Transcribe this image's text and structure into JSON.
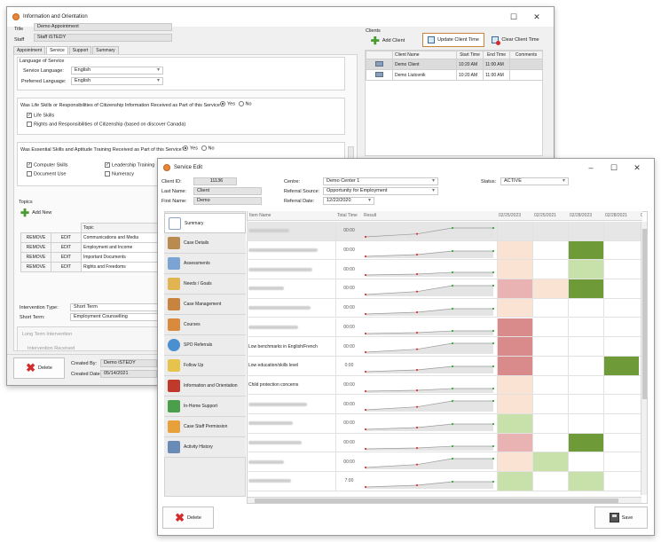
{
  "info_window": {
    "title": "Information and Orientation",
    "labels": {
      "title": "Title",
      "staff": "Staff"
    },
    "title_value": "Demo Appointment",
    "staff_value": "Staff iSTEDY",
    "tabs": [
      "Appointment",
      "Service",
      "Support",
      "Summary"
    ],
    "language_group": "Language of Service",
    "service_language_label": "Service Language:",
    "service_language": "English",
    "preferred_language_label": "Preferred Language:",
    "preferred_language": "English",
    "q_life_skills": "Was Life Skills or Responsibilities of Citizenship Information Received as Part of this Service?",
    "yes": "Yes",
    "no": "No",
    "life_skills": "Life Skills",
    "rights": "Rights and Responsibilities of Citizenship (based on discover Canada)",
    "q_essential": "Was Essential Skills and Aptitude Training Received as Part of this Service?",
    "essential_checks": [
      "Computer Skills",
      "Leadership Training",
      "Document Use",
      "Numeracy"
    ],
    "topics_label": "Topics",
    "add_new": "Add New",
    "topic_header": "Topic",
    "remove": "REMOVE",
    "edit": "EDIT",
    "topics": [
      "Communications and Media",
      "Employment and Income",
      "Important Documents",
      "Rights and Freedoms"
    ],
    "intervention_type_label": "Intervention Type:",
    "intervention_type": "Short Term",
    "short_term_label": "Short Term:",
    "short_term": "Employment Counselling",
    "long_term_label": "Long Term Intervention",
    "intervention_received": "Intervention Received",
    "delete": "Delete",
    "created_by_label": "Created By:",
    "created_by": "Demo iSTEDY",
    "created_date_label": "Created Date:",
    "created_date": "05/14/2021",
    "clients_label": "Clients",
    "add_client": "Add Client",
    "update_client_time": "Update Client Time",
    "clear_client_time": "Clear Client Time",
    "client_headers": [
      "Client Name",
      "Start Time",
      "End Time",
      "Comments"
    ],
    "clients": [
      {
        "name": "Demo Client",
        "start": "10:20 AM",
        "end": "11:00 AM",
        "comments": ""
      },
      {
        "name": "Demo Liutovnik",
        "start": "10:20 AM",
        "end": "11:00 AM",
        "comments": ""
      }
    ]
  },
  "service_window": {
    "title": "Service Edit",
    "client_id_label": "Client ID:",
    "client_id": "11136",
    "last_name_label": "Last Name:",
    "last_name": "Client",
    "first_name_label": "First Name:",
    "first_name": "Demo",
    "centre_label": "Centre:",
    "centre": "Demo Center 1",
    "referral_source_label": "Referral Source:",
    "referral_source": "Opportunity for Employment",
    "referral_date_label": "Referral Date:",
    "referral_date": "12/22/2020",
    "status_label": "Status:",
    "status": "ACTIVE",
    "sidebar": [
      "Summary",
      "Case Details",
      "Assessments",
      "Needs / Goals",
      "Case Management",
      "Courses",
      "SPO Referrals",
      "Follow Up",
      "Information and Orientation",
      "In-Home Support",
      "Case Staff Permission",
      "Activity History"
    ],
    "grid_headers": {
      "item": "Item Name",
      "time": "Total Time",
      "result": "Result",
      "dates": [
        "02/25/2023",
        "02/25/2021",
        "02/28/2023",
        "02/28/2021",
        "02/2"
      ]
    },
    "rows": [
      {
        "name": "",
        "time": "00:00"
      },
      {
        "name": "",
        "time": "00:00"
      },
      {
        "name": "",
        "time": "00:00"
      },
      {
        "name": "",
        "time": "00:00"
      },
      {
        "name": "",
        "time": "00:00"
      },
      {
        "name": "",
        "time": "00:00"
      },
      {
        "name": "Low benchmarks in English/French",
        "time": "00:00"
      },
      {
        "name": "Low education/skills level",
        "time": "0:00"
      },
      {
        "name": "Child protection concerns",
        "time": "00:00"
      },
      {
        "name": "",
        "time": "00:00"
      },
      {
        "name": "",
        "time": "00:00"
      },
      {
        "name": "",
        "time": "00:00"
      },
      {
        "name": "",
        "time": "00:00"
      },
      {
        "name": "",
        "time": "7:00"
      }
    ],
    "delete": "Delete",
    "save": "Save"
  },
  "colors": {
    "green_dark": "#6f9a38",
    "green_light": "#c8e0a9",
    "pink": "#e9b3b3",
    "pink_dark": "#d98a8a",
    "peach": "#fbe3d3"
  }
}
